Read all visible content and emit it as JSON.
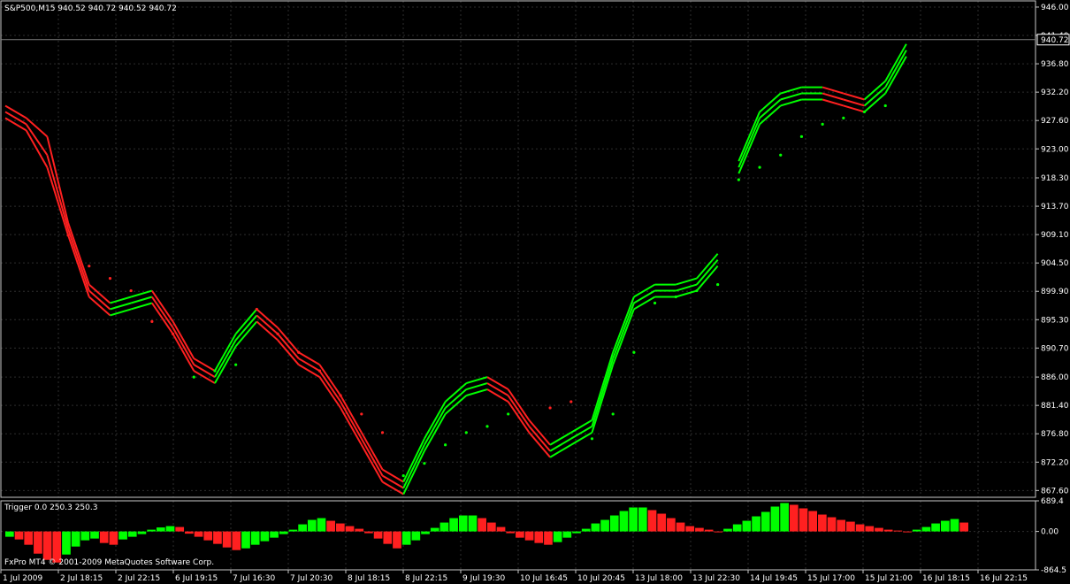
{
  "window": {
    "symbol_header": "S&P500,M15  940.52 940.72 940.52 940.72",
    "copyright": "FxPro MT4 © 2001-2009 MetaQuotes Software Corp.",
    "current_price_label": "940.72"
  },
  "colors": {
    "background": "#000000",
    "grid": "#2e2e2e",
    "axis": "#c8c8c8",
    "up": "#00ff00",
    "down": "#ff2020",
    "candle_up": "#00ff00",
    "candle_down": "#ff2020",
    "text": "#ffffff"
  },
  "chart_data": [
    {
      "type": "line",
      "title": "S&P500,M15  940.52 940.72 940.52 940.72",
      "ylim": [
        866.5,
        947.0
      ],
      "y_ticks": [
        "946.00",
        "941.40",
        "936.80",
        "932.20",
        "927.60",
        "923.00",
        "918.30",
        "913.70",
        "909.10",
        "904.50",
        "899.90",
        "895.30",
        "890.70",
        "886.00",
        "881.40",
        "876.80",
        "872.20",
        "867.60"
      ],
      "x_ticks": [
        "1 Jul 2009",
        "2 Jul 18:15",
        "2 Jul 22:15",
        "6 Jul 19:15",
        "7 Jul 16:30",
        "7 Jul 20:30",
        "8 Jul 18:15",
        "8 Jul 22:15",
        "9 Jul 19:30",
        "10 Jul 16:45",
        "10 Jul 20:45",
        "13 Jul 18:00",
        "13 Jul 22:30",
        "14 Jul 19:45",
        "15 Jul 17:00",
        "15 Jul 21:00",
        "16 Jul 18:15",
        "16 Jul 22:15"
      ],
      "current_price": 940.72,
      "x": [
        0,
        5,
        10,
        15,
        20,
        25,
        30,
        35,
        40,
        45,
        50,
        55,
        60,
        65,
        70,
        75,
        80,
        85,
        90,
        95,
        100,
        105,
        110,
        115,
        120,
        125,
        130,
        135,
        140,
        145,
        150,
        155,
        160,
        165,
        170
      ],
      "series": [
        {
          "values": [
            930,
            928,
            925,
            911,
            901,
            898,
            899,
            900,
            895,
            889,
            887,
            893,
            897,
            894,
            890,
            888,
            883,
            877,
            871,
            869,
            876,
            882,
            885,
            886,
            884,
            879,
            875,
            877,
            879,
            890,
            899,
            901,
            901,
            902,
            906
          ]
        },
        {
          "values": [
            929,
            927,
            922,
            910,
            900,
            897,
            898,
            899,
            894,
            888,
            886,
            892,
            896,
            893,
            889,
            887,
            882,
            876,
            870,
            868,
            875,
            881,
            884,
            885,
            883,
            878,
            874,
            876,
            878,
            889,
            898,
            900,
            900,
            901,
            905
          ]
        },
        {
          "values": [
            928,
            926,
            920,
            909,
            899,
            896,
            897,
            898,
            893,
            887,
            885,
            891,
            895,
            892,
            888,
            886,
            881,
            875,
            869,
            867,
            874,
            880,
            883,
            884,
            882,
            877,
            873,
            875,
            877,
            888,
            897,
            899,
            899,
            900,
            904
          ]
        },
        {
          "values": [
            null,
            null,
            null,
            909,
            904,
            902,
            900,
            895,
            893,
            null,
            null,
            null,
            897,
            893,
            890,
            887,
            883,
            880,
            877,
            null,
            null,
            null,
            null,
            null,
            null,
            null,
            881,
            882,
            null,
            null,
            null,
            null,
            null,
            null,
            null
          ]
        },
        {
          "values": [
            null,
            null,
            null,
            null,
            null,
            null,
            null,
            null,
            null,
            886,
            887,
            888,
            null,
            null,
            null,
            null,
            null,
            null,
            null,
            870,
            872,
            875,
            877,
            878,
            880,
            null,
            null,
            null,
            876,
            880,
            890,
            898,
            899,
            900,
            901
          ]
        }
      ],
      "x2": [
        175,
        180,
        185,
        190,
        195,
        200,
        205,
        210,
        215,
        220,
        225,
        230
      ],
      "series2": [
        {
          "values": [
            921,
            929,
            932,
            933,
            933,
            932,
            931,
            934,
            940,
            null,
            null,
            null
          ]
        },
        {
          "values": [
            920,
            928,
            931,
            932,
            932,
            931,
            930,
            933,
            939,
            null,
            null,
            null
          ]
        },
        {
          "values": [
            919,
            927,
            930,
            931,
            931,
            930,
            929,
            932,
            938,
            null,
            null,
            null
          ]
        },
        {
          "values": [
            918,
            920,
            922,
            925,
            927,
            928,
            929,
            930,
            null,
            null,
            null,
            null
          ]
        }
      ]
    },
    {
      "type": "bar",
      "title": "Trigger 0.0 250.3 250.3",
      "ylim": [
        -864.5,
        689.4
      ],
      "y_ticks": [
        "689.4",
        "0.00",
        "-864.5"
      ],
      "values": [
        -120,
        -180,
        -300,
        -500,
        -640,
        -700,
        -520,
        -340,
        -200,
        -160,
        -260,
        -300,
        -180,
        -120,
        -60,
        40,
        90,
        120,
        100,
        -50,
        -120,
        -200,
        -280,
        -360,
        -420,
        -380,
        -300,
        -220,
        -140,
        -60,
        40,
        160,
        260,
        300,
        240,
        180,
        120,
        60,
        -40,
        -160,
        -280,
        -380,
        -300,
        -200,
        -60,
        80,
        200,
        300,
        360,
        360,
        300,
        200,
        100,
        -40,
        -140,
        -200,
        -260,
        -300,
        -240,
        -140,
        -40,
        60,
        180,
        260,
        360,
        460,
        540,
        540,
        480,
        400,
        300,
        200,
        120,
        80,
        40,
        0,
        60,
        160,
        240,
        340,
        440,
        560,
        640,
        600,
        520,
        460,
        380,
        320,
        260,
        220,
        160,
        120,
        80,
        40,
        20,
        0,
        40,
        100,
        180,
        240,
        280,
        200
      ]
    }
  ]
}
